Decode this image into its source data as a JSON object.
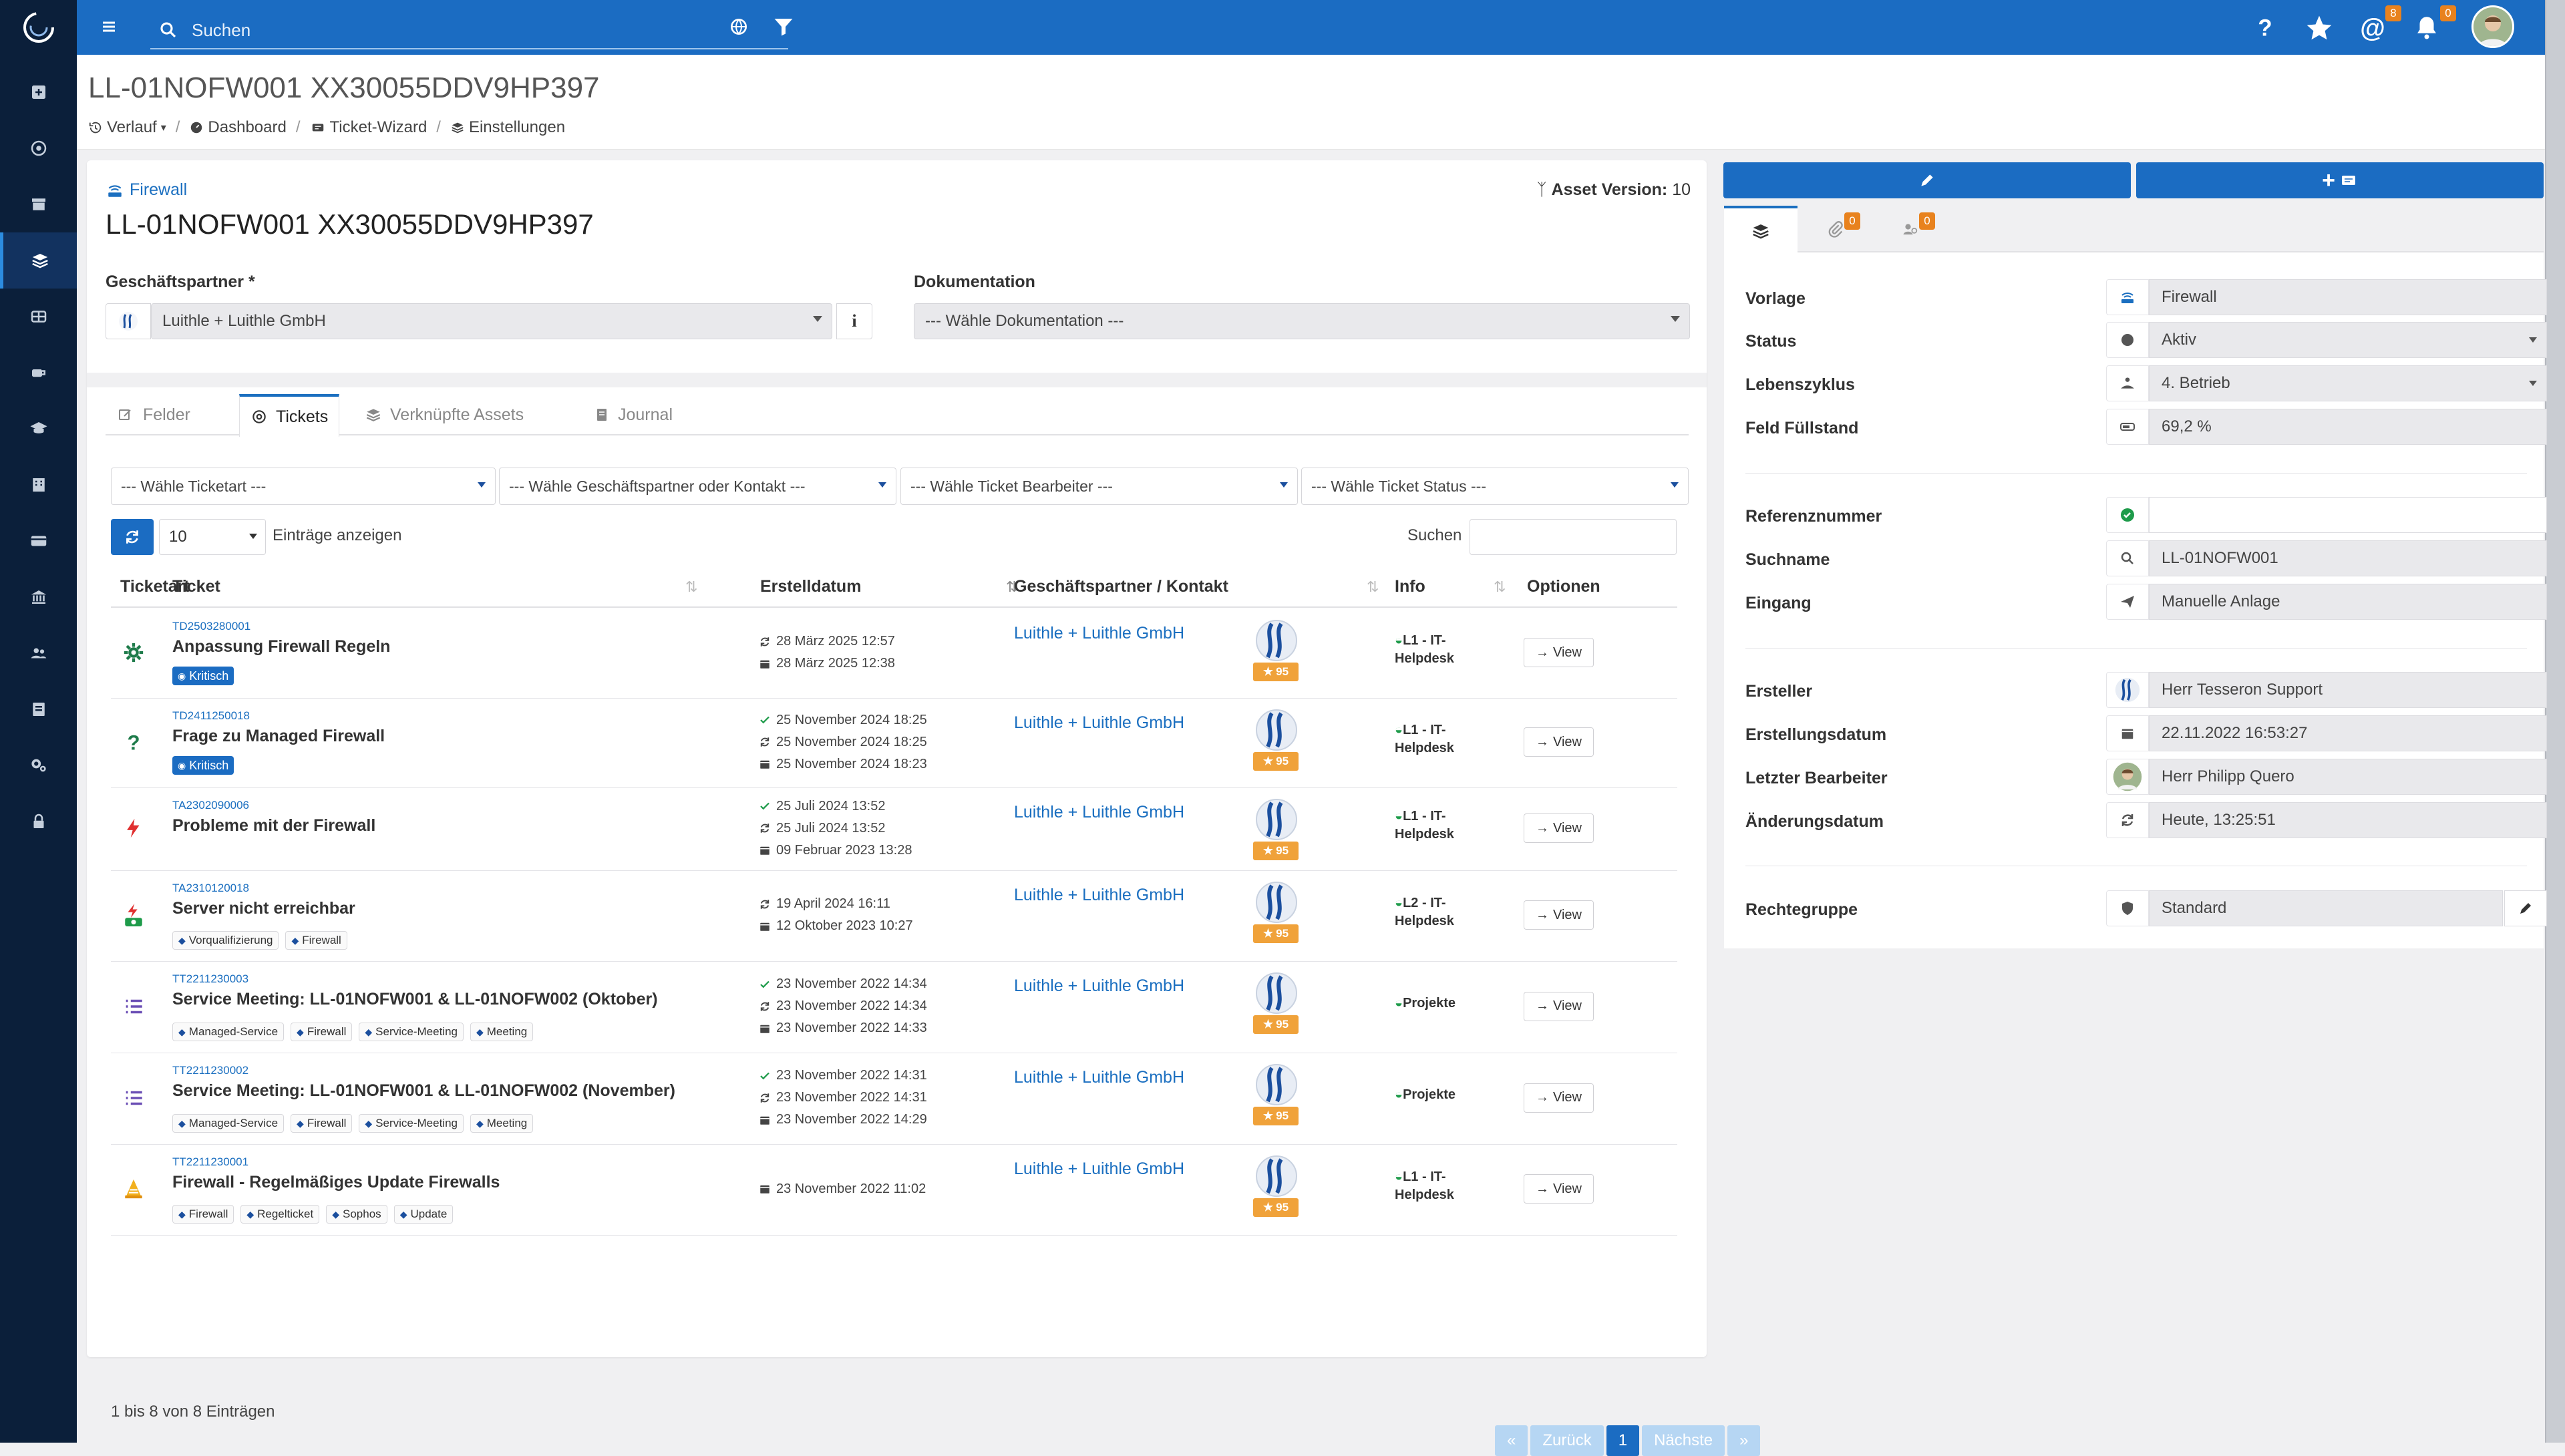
{
  "topbar": {
    "search_placeholder": "Suchen",
    "badges": {
      "mentions": "8",
      "notifications": "0"
    }
  },
  "header": {
    "title": "LL-01NOFW001 XX30055DDV9HP397",
    "breadcrumbs": [
      "Verlauf",
      "Dashboard",
      "Ticket-Wizard",
      "Einstellungen"
    ]
  },
  "asset": {
    "type": "Firewall",
    "title": "LL-01NOFW001 XX30055DDV9HP397",
    "version_label": "Asset Version:",
    "version_value": "10",
    "partner_label": "Geschäftspartner *",
    "partner_value": "Luithle + Luithle GmbH",
    "doc_label": "Dokumentation",
    "doc_value": "--- Wähle Dokumentation ---"
  },
  "tabs": [
    "Felder",
    "Tickets",
    "Verknüpfte Assets",
    "Journal"
  ],
  "filters": [
    "--- Wähle Ticketart ---",
    "--- Wähle Geschäftspartner oder Kontakt ---",
    "--- Wähle Ticket Bearbeiter ---",
    "--- Wähle Ticket Status ---"
  ],
  "table": {
    "pagesize": "10",
    "entries_label": "Einträge anzeigen",
    "search_label": "Suchen",
    "headers": [
      "Ticketart",
      "Ticket",
      "Erstelldatum",
      "Geschäftspartner / Kontakt",
      "Info",
      "Optionen"
    ],
    "view_label": "View",
    "rows": [
      {
        "number": "TD2503280001",
        "title": "Anpassung Firewall Regeln",
        "badge": "Kritisch",
        "tags": [],
        "dates": [
          "28 März 2025 12:57",
          "28 März 2025 12:38"
        ],
        "partner": "Luithle + Luithle GmbH",
        "score": "95",
        "info": [
          "L1 - IT-",
          "Helpdesk"
        ]
      },
      {
        "number": "TD2411250018",
        "title": "Frage zu Managed Firewall",
        "badge": "Kritisch",
        "tags": [],
        "dates": [
          "25 November 2024 18:25",
          "25 November 2024 18:25",
          "25 November 2024 18:23"
        ],
        "partner": "Luithle + Luithle GmbH",
        "score": "95",
        "info": [
          "L1 - IT-",
          "Helpdesk"
        ]
      },
      {
        "number": "TA2302090006",
        "title": "Probleme mit der Firewall",
        "badge": "",
        "tags": [],
        "dates": [
          "25 Juli 2024 13:52",
          "25 Juli 2024 13:52",
          "09 Februar 2023 13:28"
        ],
        "partner": "Luithle + Luithle GmbH",
        "score": "95",
        "info": [
          "L1 - IT-",
          "Helpdesk"
        ]
      },
      {
        "number": "TA2310120018",
        "title": "Server nicht erreichbar",
        "badge": "",
        "tags": [
          "Vorqualifizierung",
          "Firewall"
        ],
        "dates": [
          "19 April 2024 16:11",
          "12 Oktober 2023 10:27"
        ],
        "partner": "Luithle + Luithle GmbH",
        "score": "95",
        "info": [
          "L2 - IT-",
          "Helpdesk"
        ]
      },
      {
        "number": "TT2211230003",
        "title": "Service Meeting: LL-01NOFW001 & LL-01NOFW002 (Oktober)",
        "badge": "",
        "tags": [
          "Managed-Service",
          "Firewall",
          "Service-Meeting",
          "Meeting"
        ],
        "dates": [
          "23 November 2022 14:34",
          "23 November 2022 14:34",
          "23 November 2022 14:33"
        ],
        "partner": "Luithle + Luithle GmbH",
        "score": "95",
        "info": [
          "Projekte"
        ]
      },
      {
        "number": "TT2211230002",
        "title": "Service Meeting: LL-01NOFW001 & LL-01NOFW002 (November)",
        "badge": "",
        "tags": [
          "Managed-Service",
          "Firewall",
          "Service-Meeting",
          "Meeting"
        ],
        "dates": [
          "23 November 2022 14:31",
          "23 November 2022 14:31",
          "23 November 2022 14:29"
        ],
        "partner": "Luithle + Luithle GmbH",
        "score": "95",
        "info": [
          "Projekte"
        ]
      },
      {
        "number": "TT2211230001",
        "title": "Firewall - Regelmäßiges Update Firewalls",
        "badge": "",
        "tags": [
          "Firewall",
          "Regelticket",
          "Sophos",
          "Update"
        ],
        "dates": [
          "23 November 2022 11:02"
        ],
        "partner": "Luithle + Luithle GmbH",
        "score": "95",
        "info": [
          "L1 - IT-",
          "Helpdesk"
        ]
      }
    ],
    "footer": "1 bis 8 von 8 Einträgen",
    "pager": {
      "prev": "Zurück",
      "current": "1",
      "next": "Nächste"
    }
  },
  "panel": {
    "tab_badges": [
      "0",
      "0"
    ],
    "props": [
      {
        "label": "Vorlage",
        "value": "Firewall"
      },
      {
        "label": "Status",
        "value": "Aktiv"
      },
      {
        "label": "Lebenszyklus",
        "value": "4. Betrieb"
      },
      {
        "label": "Feld Füllstand",
        "value": "69,2 %"
      },
      {
        "label": "Referenznummer",
        "value": ""
      },
      {
        "label": "Suchname",
        "value": "LL-01NOFW001"
      },
      {
        "label": "Eingang",
        "value": "Manuelle Anlage"
      },
      {
        "label": "Ersteller",
        "value": "Herr Tesseron Support"
      },
      {
        "label": "Erstellungsdatum",
        "value": "22.11.2022 16:53:27"
      },
      {
        "label": "Letzter Bearbeiter",
        "value": "Herr Philipp Quero"
      },
      {
        "label": "Änderungsdatum",
        "value": "Heute, 13:25:51"
      },
      {
        "label": "Rechtegruppe",
        "value": "Standard"
      }
    ]
  },
  "colors": {
    "primary": "#1b6cc2",
    "sidebar": "#0b1f3a",
    "badge_orange": "#e8821e",
    "score": "#f0a23a"
  }
}
